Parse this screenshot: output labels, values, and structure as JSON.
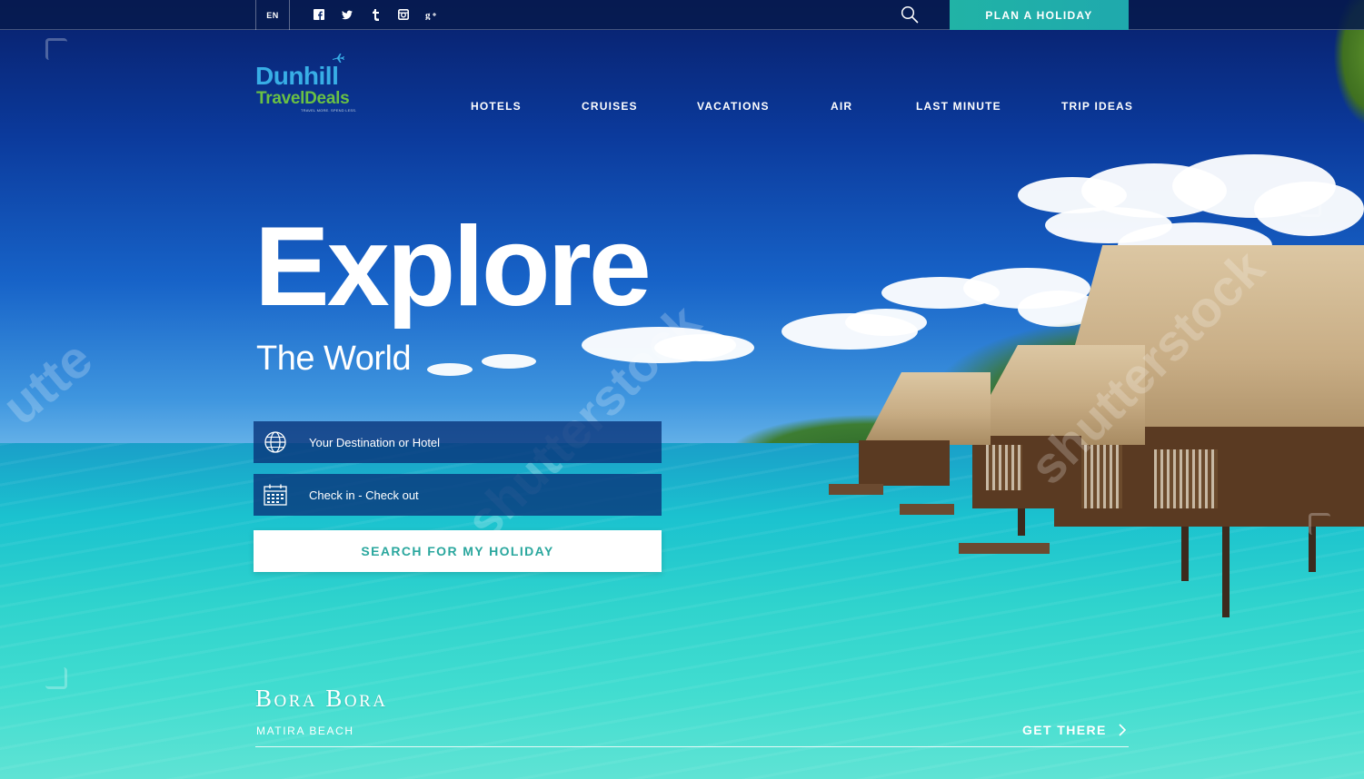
{
  "topbar": {
    "language": "EN",
    "socials": [
      {
        "icon": "facebook-icon",
        "glyph": "f"
      },
      {
        "icon": "twitter-icon",
        "glyph": "🐦"
      },
      {
        "icon": "tumblr-icon",
        "glyph": "t"
      },
      {
        "icon": "instagram-icon",
        "glyph": "◙"
      },
      {
        "icon": "google-plus-icon",
        "glyph": "g+"
      }
    ],
    "plan_button": "PLAN A HOLIDAY"
  },
  "brand": {
    "line1": "Dunhill",
    "line2": "TravelDeals",
    "tagline": "TRAVEL MORE. SPEND LESS.",
    "colors": {
      "blue": "#38aee6",
      "green": "#6ac144"
    }
  },
  "nav": {
    "items": [
      "HOTELS",
      "CRUISES",
      "VACATIONS",
      "AIR",
      "LAST MINUTE",
      "TRIP IDEAS"
    ]
  },
  "hero": {
    "title": "Explore",
    "subtitle": "The World"
  },
  "search": {
    "destination_placeholder": "Your Destination or Hotel",
    "dates_placeholder": "Check in - Check out",
    "submit": "SEARCH FOR MY HOLIDAY"
  },
  "destination": {
    "name": "Bora Bora",
    "place": "MATIRA BEACH",
    "cta": "GET THERE"
  },
  "watermark": {
    "text": "shutterstock",
    "fragment": "utte"
  },
  "colors": {
    "accent": "#21b3a6",
    "button_text": "#2aa79e"
  }
}
